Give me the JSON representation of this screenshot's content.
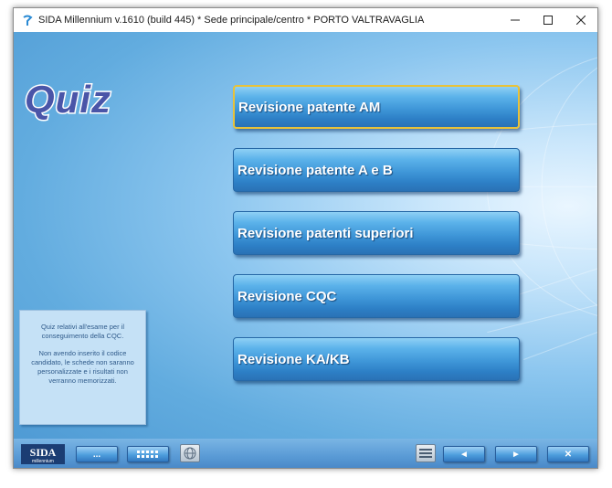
{
  "window": {
    "title": "SIDA Millennium v.1610 (build 445) * Sede principale/centro * PORTO VALTRAVAGLIA",
    "controls": {
      "minimize": "—",
      "maximize": "☐",
      "close": "✕"
    }
  },
  "logo": {
    "text": "Quiz"
  },
  "menu": {
    "items": [
      {
        "label": "Revisione patente AM"
      },
      {
        "label": "Revisione patente A e B"
      },
      {
        "label": "Revisione patenti superiori"
      },
      {
        "label": "Revisione CQC"
      },
      {
        "label": "Revisione KA/KB"
      }
    ],
    "selected_index": 0
  },
  "info": {
    "line1": "Quiz relativi all'esame per il conseguimento della CQC.",
    "line2": "Non avendo inserito il codice candidato, le schede non saranno personalizzate e i risultati non verranno memorizzati."
  },
  "bottombar": {
    "brand": "SIDA",
    "brand_sub": "millennium",
    "more_label": "...",
    "keypad_label": "!!!!!!",
    "prev_label": "◄",
    "next_label": "►",
    "close_label": "✕"
  },
  "colors": {
    "accent": "#3f97d8",
    "selected_border": "#e8c23a",
    "info_text": "#2f5a8a"
  }
}
